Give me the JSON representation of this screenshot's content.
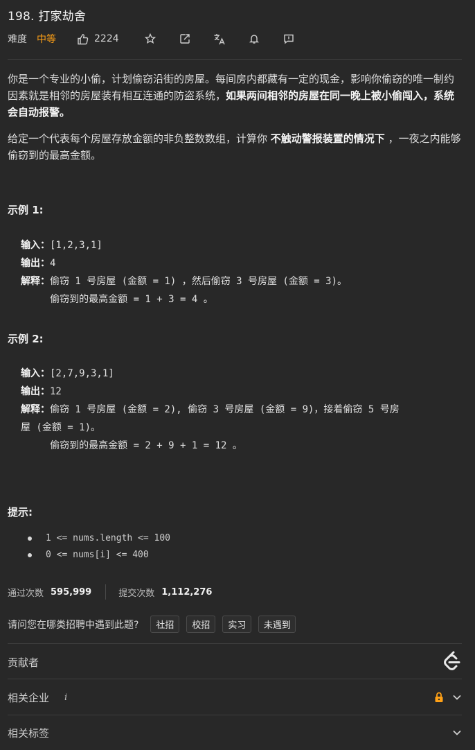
{
  "problem": {
    "title": "198. 打家劫舍",
    "difficulty_label": "难度",
    "difficulty": "中等",
    "likes": "2224",
    "colors": {
      "difficulty": "#ffa116",
      "lock": "#ffa116"
    }
  },
  "icons": {
    "like": "thumb-up-icon",
    "star": "star-icon",
    "share": "share-icon",
    "translate": "translate-icon",
    "notify": "bell-icon",
    "feedback": "feedback-icon",
    "contributor_logo": "leetcode-logo",
    "lock": "lock-icon",
    "chevron": "chevron-down-icon"
  },
  "description": {
    "p1_plain": "你是一个专业的小偷，计划偷窃沿街的房屋。每间房内都藏有一定的现金，影响你偷窃的唯一制约因素就是相邻的房屋装有相互连通的防盗系统，",
    "p1_bold": "如果两间相邻的房屋在同一晚上被小偷闯入，系统会自动报警。",
    "p2_a": "给定一个代表每个房屋存放金额的非负整数数组，计算你 ",
    "p2_bold": "不触动警报装置的情况下",
    "p2_b": " ，一夜之内能够偷窃到的最高金额。"
  },
  "examples": [
    {
      "title": "示例 1:",
      "input_label": "输入：",
      "input": "[1,2,3,1]",
      "output_label": "输出：",
      "output": "4",
      "explain_label": "解释：",
      "explain_line1": "偷窃 1 号房屋 (金额 = 1) ，然后偷窃 3 号房屋 (金额 = 3)。",
      "explain_line2": "     偷窃到的最高金额 = 1 + 3 = 4 。"
    },
    {
      "title": "示例 2:",
      "input_label": "输入：",
      "input": "[2,7,9,3,1]",
      "output_label": "输出：",
      "output": "12",
      "explain_label": "解释：",
      "explain_line1": "偷窃 1 号房屋 (金额 = 2), 偷窃 3 号房屋 (金额 = 9)，接着偷窃 5 号房",
      "explain_line2": "屋 (金额 = 1)。",
      "explain_line3": "     偷窃到的最高金额 = 2 + 9 + 1 = 12 。"
    }
  ],
  "hints": {
    "title": "提示:",
    "constraints": [
      "1 <= nums.length <= 100",
      "0 <= nums[i] <= 400"
    ]
  },
  "stats": {
    "accepted_label": "通过次数",
    "accepted": "595,999",
    "submissions_label": "提交次数",
    "submissions": "1,112,276"
  },
  "recruit": {
    "question": "请问您在哪类招聘中遇到此题?",
    "options": [
      "社招",
      "校招",
      "实习",
      "未遇到"
    ]
  },
  "sections": {
    "contributors": "贡献者",
    "companies": "相关企业",
    "companies_info": "i",
    "tags": "相关标签"
  }
}
